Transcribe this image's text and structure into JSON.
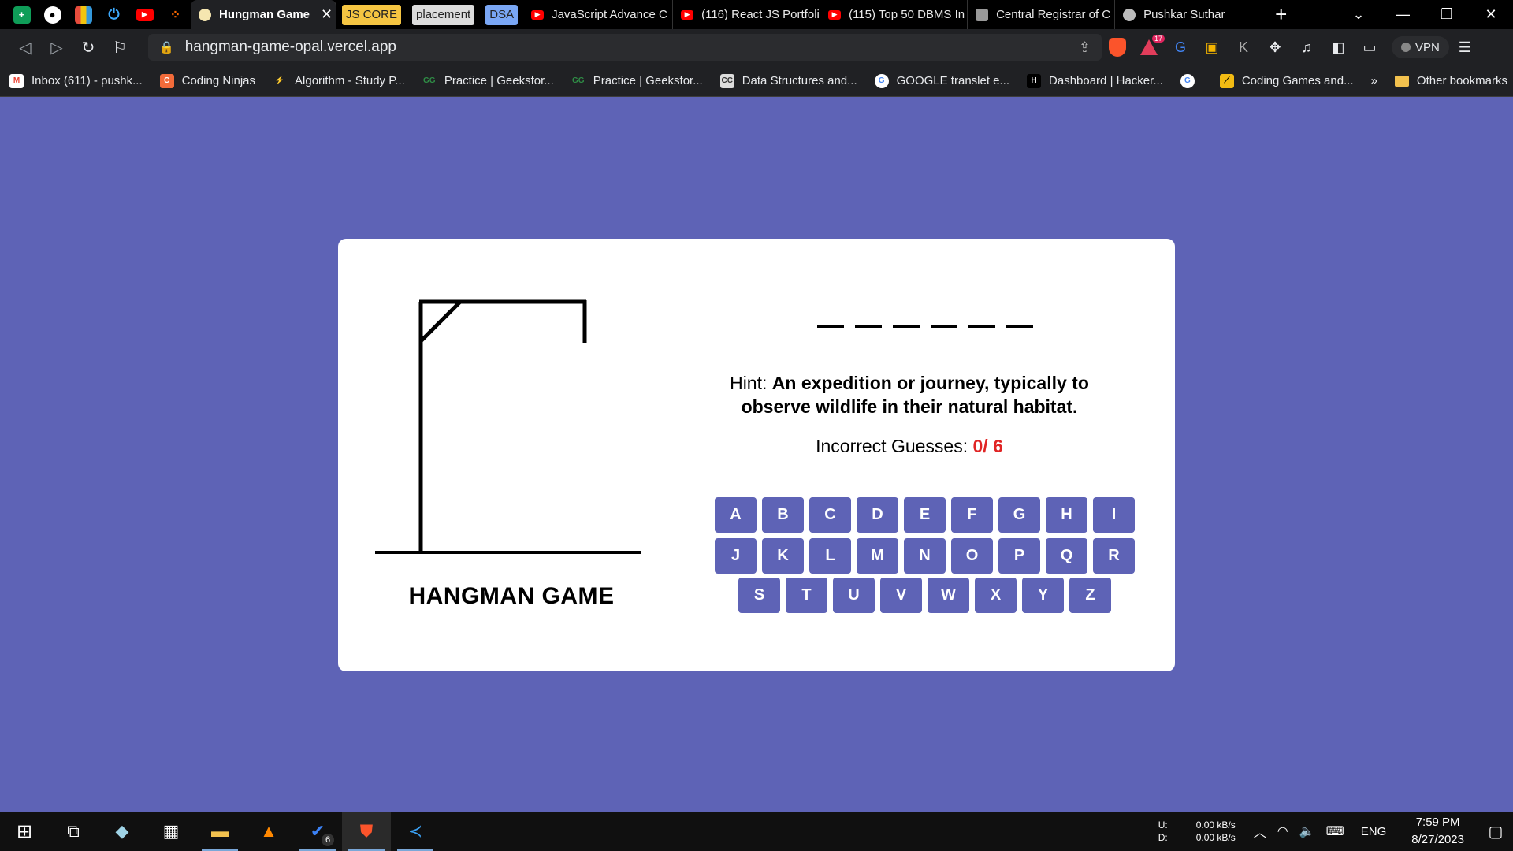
{
  "browser": {
    "tabs": [
      {
        "label": "Hungman Game",
        "active": true
      },
      {
        "label": "JS CORE",
        "group": true,
        "color": "#f5c542"
      },
      {
        "label": "placement",
        "group": true,
        "color": "#dcdcdc"
      },
      {
        "label": "DSA",
        "group": true,
        "color": "#7aa7f5"
      },
      {
        "label": "JavaScript Advance C",
        "icon": "youtube-icon"
      },
      {
        "label": "(116) React JS Portfoli",
        "icon": "youtube-icon"
      },
      {
        "label": "(115) Top 50 DBMS In",
        "icon": "youtube-icon"
      },
      {
        "label": "Central Registrar of C",
        "icon": "document-icon"
      },
      {
        "label": "Pushkar Suthar",
        "icon": "globe-icon"
      }
    ],
    "new_tab_label": "+",
    "url": "hangman-game-opal.vercel.app",
    "vpn_label": "VPN",
    "extension_badge": "17",
    "bookmarks": [
      {
        "label": "Inbox (611) - pushk...",
        "icon": "gmail-icon"
      },
      {
        "label": "Coding Ninjas",
        "icon": "coding-ninjas-icon"
      },
      {
        "label": "Algorithm - Study P...",
        "icon": "algorithm-icon"
      },
      {
        "label": "Practice | Geeksfor...",
        "icon": "geeksforgeeks-icon"
      },
      {
        "label": "Practice | Geeksfor...",
        "icon": "geeksforgeeks-icon"
      },
      {
        "label": "Data Structures and...",
        "icon": "cc-icon"
      },
      {
        "label": "GOOGLE translet e...",
        "icon": "google-icon"
      },
      {
        "label": "Dashboard | Hacker...",
        "icon": "hackerrank-icon"
      },
      {
        "label": "",
        "icon": "google-icon"
      },
      {
        "label": "Coding Games and...",
        "icon": "codingame-icon"
      }
    ],
    "bookmarks_overflow": "»",
    "other_bookmarks": "Other bookmarks"
  },
  "game": {
    "title": "HANGMAN GAME",
    "word_length": 6,
    "hint_label": "Hint:",
    "hint_text": "An expedition or journey, typically to observe wildlife in their natural habitat.",
    "guesses_label": "Incorrect Guesses:",
    "guesses_value": "0/ 6",
    "keyboard_rows": [
      [
        "A",
        "B",
        "C",
        "D",
        "E",
        "F",
        "G",
        "H",
        "I"
      ],
      [
        "J",
        "K",
        "L",
        "M",
        "N",
        "O",
        "P",
        "Q",
        "R"
      ],
      [
        "S",
        "T",
        "U",
        "V",
        "W",
        "X",
        "Y",
        "Z"
      ]
    ]
  },
  "taskbar": {
    "net_up_label": "U:",
    "net_down_label": "D:",
    "net_up": "0.00 kB/s",
    "net_down": "0.00 kB/s",
    "language": "ENG",
    "time": "7:59 PM",
    "date": "8/27/2023",
    "todo_badge": "6"
  },
  "colors": {
    "page_background": "#5e63b6",
    "key_background": "#5e63b6",
    "incorrect_count": "#e02424"
  }
}
